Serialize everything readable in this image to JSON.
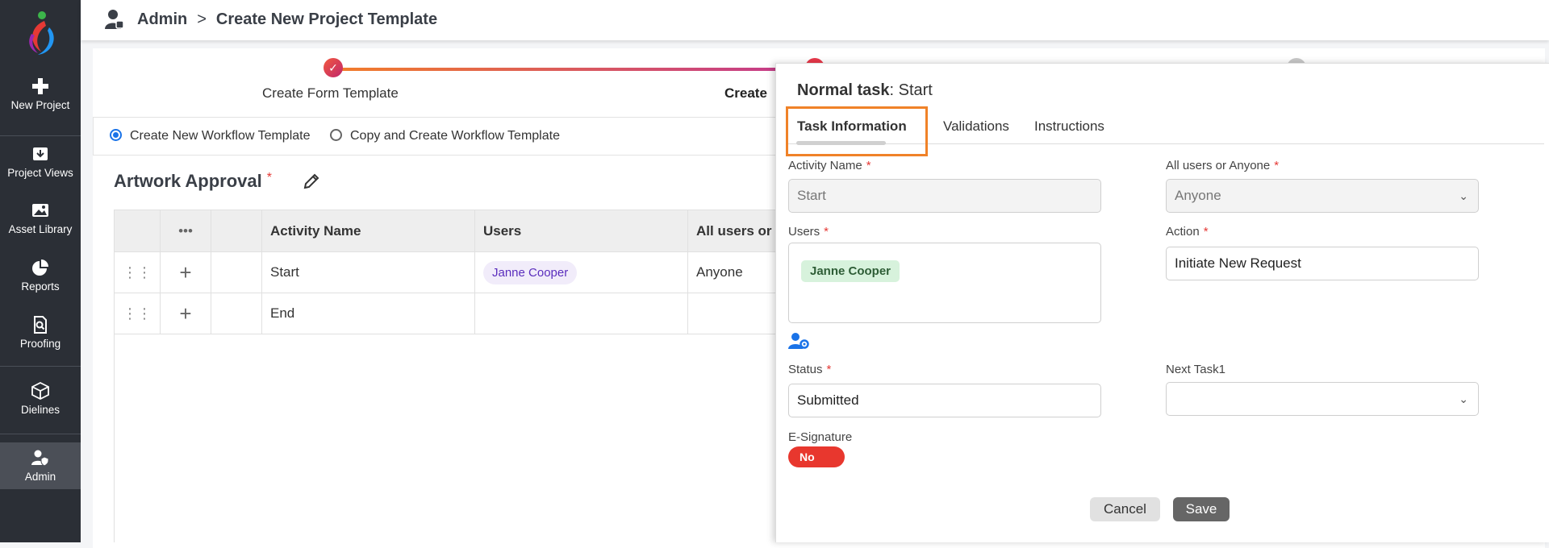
{
  "sidebar": {
    "items": [
      {
        "label": "New Project",
        "icon": "plus-icon"
      },
      {
        "label": "Project Views",
        "icon": "inbox-download-icon"
      },
      {
        "label": "Asset Library",
        "icon": "image-icon"
      },
      {
        "label": "Reports",
        "icon": "pie-chart-icon"
      },
      {
        "label": "Proofing",
        "icon": "document-search-icon"
      },
      {
        "label": "Dielines",
        "icon": "box-icon"
      },
      {
        "label": "Admin",
        "icon": "user-shield-icon"
      }
    ],
    "active_item": "Admin"
  },
  "breadcrumb": {
    "root": "Admin",
    "separator": ">",
    "current": "Create New Project Template"
  },
  "stepper": {
    "step1_label": "Create Form Template",
    "step2_label": "Create",
    "step1_icon": "check-icon"
  },
  "workflow_options": {
    "option1": "Create New Workflow Template",
    "option2": "Copy and Create Workflow Template",
    "selected": "Create New Workflow Template"
  },
  "workflow": {
    "title": "Artwork Approval",
    "required_mark": "*",
    "columns": [
      "•••",
      "Activity Name",
      "Users",
      "All users or A"
    ],
    "rows": [
      {
        "activity": "Start",
        "user": "Janne Cooper",
        "all_users": "Anyone"
      },
      {
        "activity": "End",
        "user": "",
        "all_users": ""
      }
    ]
  },
  "panel": {
    "title_bold": "Normal task",
    "title_rest": ": Start",
    "tabs": [
      "Task Information",
      "Validations",
      "Instructions"
    ],
    "active_tab": "Task Information",
    "fields": {
      "activity_name_label": "Activity Name",
      "activity_name_value": "Start",
      "all_users_label": "All users or Anyone",
      "all_users_value": "Anyone",
      "users_label": "Users",
      "users_chip": "Janne Cooper",
      "action_label": "Action",
      "action_value": "Initiate New Request",
      "status_label": "Status",
      "status_value": "Submitted",
      "next_task_label": "Next Task1",
      "next_task_value": "",
      "esign_label": "E-Signature",
      "esign_value": "No"
    },
    "required_mark": "*",
    "cancel_label": "Cancel",
    "save_label": "Save"
  },
  "colors": {
    "accent": "#1a73e8",
    "highlight": "#f08228",
    "toggle_off": "#e8372e",
    "sidebar": "#2b2f36"
  }
}
